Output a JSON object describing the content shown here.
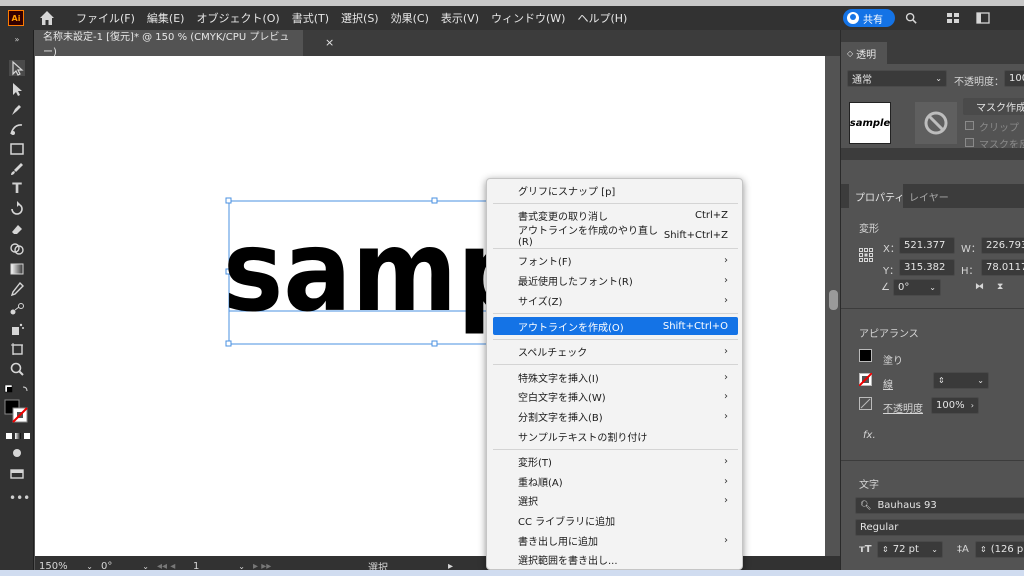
{
  "app": {
    "logo_text": "Ai",
    "share_label": "共有"
  },
  "menu": [
    "ファイル(F)",
    "編集(E)",
    "オブジェクト(O)",
    "書式(T)",
    "選択(S)",
    "効果(C)",
    "表示(V)",
    "ウィンドウ(W)",
    "ヘルプ(H)"
  ],
  "document": {
    "tab_title": "名称未設定-1 [復元]* @ 150 % (CMYK/CPU プレビュー)",
    "close": "×",
    "canvas_text": "sample"
  },
  "status": {
    "zoom": "150%",
    "rotation": "0°",
    "artboard": "1",
    "tool": "選択"
  },
  "context_menu": {
    "items": [
      {
        "label": "グリフにスナップ [p]",
        "shortcut": "",
        "submenu": false,
        "highlighted": false
      },
      {
        "label": "書式変更の取り消し",
        "shortcut": "Ctrl+Z",
        "submenu": false,
        "highlighted": false
      },
      {
        "label": "アウトラインを作成のやり直し(R)",
        "shortcut": "Shift+Ctrl+Z",
        "submenu": false,
        "highlighted": false
      },
      {
        "label": "フォント(F)",
        "shortcut": "",
        "submenu": true,
        "highlighted": false
      },
      {
        "label": "最近使用したフォント(R)",
        "shortcut": "",
        "submenu": true,
        "highlighted": false
      },
      {
        "label": "サイズ(Z)",
        "shortcut": "",
        "submenu": true,
        "highlighted": false
      },
      {
        "label": "アウトラインを作成(O)",
        "shortcut": "Shift+Ctrl+O",
        "submenu": false,
        "highlighted": true
      },
      {
        "label": "スペルチェック",
        "shortcut": "",
        "submenu": true,
        "highlighted": false
      },
      {
        "label": "特殊文字を挿入(I)",
        "shortcut": "",
        "submenu": true,
        "highlighted": false
      },
      {
        "label": "空白文字を挿入(W)",
        "shortcut": "",
        "submenu": true,
        "highlighted": false
      },
      {
        "label": "分割文字を挿入(B)",
        "shortcut": "",
        "submenu": true,
        "highlighted": false
      },
      {
        "label": "サンプルテキストの割り付け",
        "shortcut": "",
        "submenu": false,
        "highlighted": false
      },
      {
        "label": "変形(T)",
        "shortcut": "",
        "submenu": true,
        "highlighted": false
      },
      {
        "label": "重ね順(A)",
        "shortcut": "",
        "submenu": true,
        "highlighted": false
      },
      {
        "label": "選択",
        "shortcut": "",
        "submenu": true,
        "highlighted": false
      },
      {
        "label": "CC ライブラリに追加",
        "shortcut": "",
        "submenu": false,
        "highlighted": false
      },
      {
        "label": "書き出し用に追加",
        "shortcut": "",
        "submenu": true,
        "highlighted": false
      },
      {
        "label": "選択範囲を書き出し...",
        "shortcut": "",
        "submenu": false,
        "highlighted": false
      }
    ]
  },
  "transparency_panel": {
    "title": "透明",
    "blend_mode": "通常",
    "opacity_label": "不透明度：",
    "opacity_value": "100",
    "thumbnail_text": "sample",
    "mask_button": "マスク作成",
    "clip_label": "クリップ",
    "invert_label": "マスクを反転"
  },
  "properties_panel": {
    "tabs": [
      "プロパティ",
      "レイヤー"
    ],
    "transform": {
      "title": "変形",
      "x_label": "X：",
      "x": "521.377",
      "y_label": "Y：",
      "y": "315.382",
      "w_label": "W：",
      "w": "226.793",
      "h_label": "H：",
      "h": "78.0117",
      "angle": "0°"
    },
    "appearance": {
      "title": "アピアランス",
      "fill": "塗り",
      "stroke": "線",
      "opacity_label": "不透明度",
      "opacity_value": "100%",
      "fx": "fx."
    },
    "type": {
      "title": "文字",
      "font": "Bauhaus 93",
      "style": "Regular",
      "size": "72 pt",
      "leading": "(126 p"
    }
  },
  "colors": {
    "accent": "#1473e6",
    "menubar": "#323232",
    "panel": "#535353",
    "canvas": "#ffffff"
  },
  "icons": [
    "home-icon",
    "search-icon",
    "arrange-icon",
    "panel-icon",
    "selection-tool-icon",
    "direct-selection-tool-icon",
    "pen-tool-icon",
    "curvature-tool-icon",
    "rectangle-tool-icon",
    "paintbrush-tool-icon",
    "type-tool-icon",
    "rotate-tool-icon",
    "eraser-tool-icon",
    "shape-builder-icon",
    "gradient-tool-icon",
    "eyedropper-tool-icon",
    "blend-tool-icon",
    "symbol-sprayer-icon",
    "artboard-tool-icon",
    "zoom-tool-icon",
    "fill-stroke-icon",
    "more-tools-icon"
  ]
}
